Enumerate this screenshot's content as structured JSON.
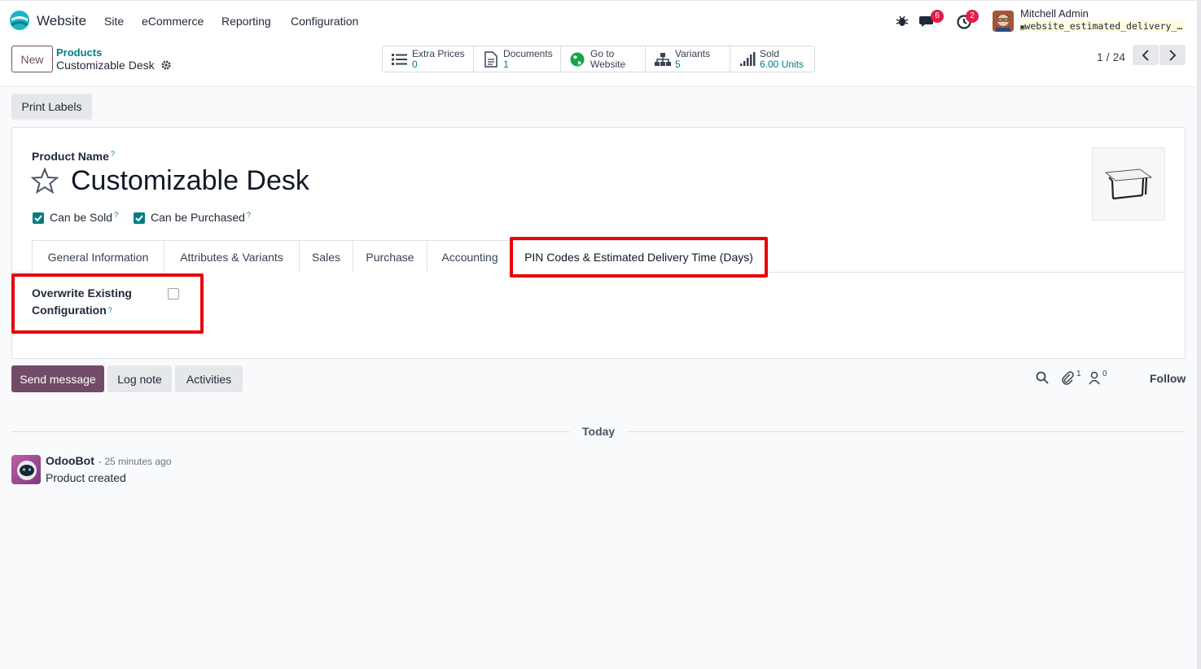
{
  "nav": {
    "app_name": "Website",
    "menu": [
      "Site",
      "eCommerce",
      "Reporting",
      "Configuration"
    ],
    "messages_badge": "6",
    "activities_badge": "2",
    "user_name": "Mitchell Admin",
    "db_name": "website_estimated_delivery_time"
  },
  "control": {
    "new_label": "New",
    "breadcrumb_parent": "Products",
    "breadcrumb_current": "Customizable Desk",
    "smart_buttons": [
      {
        "title": "Extra Prices",
        "value": "0",
        "icon": "list-icon"
      },
      {
        "title": "Documents",
        "value": "1",
        "icon": "document-icon"
      },
      {
        "title": "Go to",
        "value": "Website",
        "icon": "globe-icon"
      },
      {
        "title": "Variants",
        "value": "5",
        "icon": "sitemap-icon"
      },
      {
        "title": "Sold",
        "value": "6.00 Units",
        "icon": "bar-signal-icon"
      }
    ],
    "pager": "1 / 24"
  },
  "form": {
    "print_labels": "Print Labels",
    "product_name_label": "Product Name",
    "help_mark": "?",
    "product_name": "Customizable Desk",
    "can_be_sold": "Can be Sold",
    "can_be_purchased": "Can be Purchased",
    "tabs": [
      "General Information",
      "Attributes & Variants",
      "Sales",
      "Purchase",
      "Accounting",
      "PIN Codes & Estimated Delivery Time (Days)"
    ],
    "active_tab_index": 5,
    "overwrite_label_line1": "Overwrite Existing",
    "overwrite_label_line2": "Configuration",
    "overwrite_checked": false,
    "highlight_color": "#e8000b"
  },
  "chatter": {
    "send_message": "Send message",
    "log_note": "Log note",
    "activities": "Activities",
    "attachments_count": "1",
    "followers_count": "0",
    "follow": "Follow",
    "today": "Today",
    "author": "OdooBot",
    "time": "- 25 minutes ago",
    "message": "Product created"
  },
  "colors": {
    "primary": "#714b67",
    "accent": "#017e84",
    "badge": "#e11d48"
  }
}
